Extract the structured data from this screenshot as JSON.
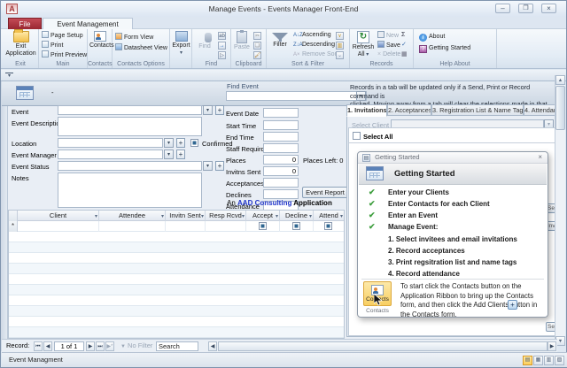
{
  "window": {
    "title": "Manage Events  -  Events Manager Front-End",
    "app_initial": "A"
  },
  "icons": {
    "dropdown": "▾",
    "plus": "+",
    "close": "×",
    "minimize": "–",
    "caret_up": "▴",
    "help": "?",
    "check": "✔",
    "sigma": "Σ",
    "refresh": "↻",
    "up": "▲",
    "down": "▼",
    "left": "◀",
    "right": "▶",
    "first": "⏮",
    "last": "⏭",
    "new_record": "▶*",
    "asterisk": "*",
    "scissors": "✂",
    "spell": "✓"
  },
  "ribbon": {
    "file_tab": "File",
    "active_tab": "Event Management",
    "exit": {
      "label": "Exit",
      "exit_application": "Exit Application"
    },
    "main": {
      "label": "Main",
      "page_setup": "Page Setup",
      "print": "Print",
      "print_preview": "Print Preview"
    },
    "contacts": {
      "label": "Contacts",
      "button": "Contacts"
    },
    "contacts_options": {
      "label": "Contacts Options",
      "form_view": "Form View",
      "datasheet_view": "Datasheet View"
    },
    "export": {
      "button": "Export"
    },
    "find": {
      "label": "Find",
      "button": "Find"
    },
    "clipboard": {
      "label": "Clipboard",
      "paste": "Paste"
    },
    "sort_filter": {
      "label": "Sort & Filter",
      "filter": "Filter",
      "ascending": "Ascending",
      "descending": "Descending",
      "remove_sort": "Remove Sort"
    },
    "records": {
      "label": "Records",
      "refresh_all": "Refresh All",
      "new": "New",
      "save": "Save",
      "delete": "Delete"
    },
    "help_about": {
      "label": "Help About",
      "about": "About",
      "getting_started": "Getting Started"
    }
  },
  "form_header": {
    "dash": "-",
    "find_event_label": "Find Event"
  },
  "form": {
    "labels_left": [
      "Event",
      "Event Description",
      "Location",
      "Event Manager",
      "Event Status",
      "Notes"
    ],
    "confirmed": "Confirmed",
    "rows_right": [
      {
        "label": "Event Date",
        "value": ""
      },
      {
        "label": "Start Time",
        "value": ""
      },
      {
        "label": "End Time",
        "value": ""
      },
      {
        "label": "Staff Requird",
        "value": ""
      },
      {
        "label": "Places",
        "value": "0"
      },
      {
        "label": "Invitns Sent",
        "value": "0"
      },
      {
        "label": "Acceptances",
        "value": ""
      },
      {
        "label": "Declines",
        "value": ""
      },
      {
        "label": "Attendance",
        "value": ""
      }
    ],
    "places_left": "Places Left:  0",
    "event_report_button": "Event Report",
    "branding": {
      "an": "An ",
      "brand": "AAD Consulting",
      "app": " Application"
    }
  },
  "grid": {
    "columns": [
      "Client",
      "Attendee",
      "Invitn Sent",
      "Resp Rcvd",
      "Accept",
      "Decline",
      "Attend"
    ],
    "new_record_marker": "*"
  },
  "panel": {
    "notice_line1": "Records in a tab will be updated only if a Send, Print or Record command is",
    "notice_line2": "clicked.   Moving away from a tab will clear the selections made in that tab.",
    "tabs": [
      "1. Invitations",
      "2. Acceptances",
      "3. Registration List & Name Tags",
      "4. Attendance"
    ],
    "select_client_label": "Select Client",
    "select_all_label": "Select All",
    "clipped_buttons": [
      "Sess",
      "Inv",
      "Sen"
    ]
  },
  "popup": {
    "titlebar": "Getting Started",
    "heading": "Getting Started",
    "checklist": [
      "Enter your Clients",
      "Enter Contacts for each Client",
      "Enter an Event",
      "Manage Event:"
    ],
    "steps": [
      "1. Select invitees and email invitations",
      "2. Record acceptances",
      "3. Print regsitration list and name tags",
      "4. Record attendance"
    ],
    "contacts_button_label": "Contacts",
    "contacts_caption": "Contacts",
    "instruction": "To start click  the Contacts button on the Application Ribbon to bring up the Contacts form, and then click the Add Clients button       in the Contacts form.",
    "plus_button": "+"
  },
  "record_nav": {
    "label": "Record:",
    "position": "1 of 1",
    "no_filter": "No Filter",
    "search": "Search"
  },
  "status_bar": {
    "text": "Event Managment"
  }
}
